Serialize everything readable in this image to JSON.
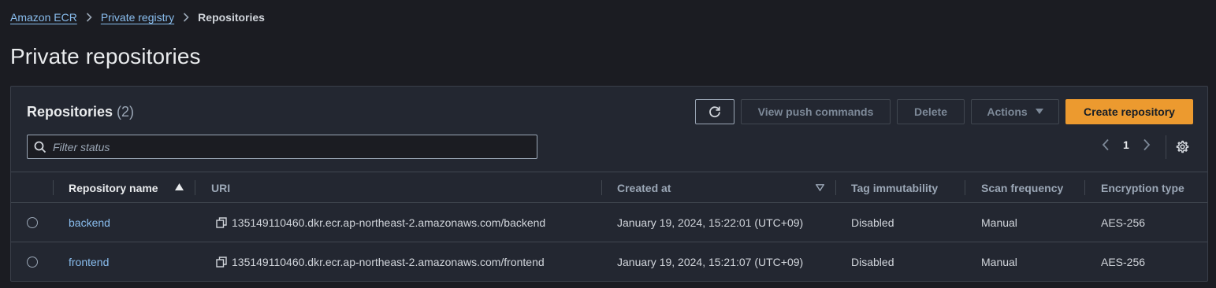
{
  "breadcrumb": {
    "items": [
      "Amazon ECR",
      "Private registry"
    ],
    "current": "Repositories"
  },
  "page": {
    "title": "Private repositories"
  },
  "panel": {
    "title": "Repositories",
    "count": "(2)",
    "buttons": {
      "view_push": "View push commands",
      "delete": "Delete",
      "actions": "Actions",
      "create": "Create repository"
    },
    "filter_placeholder": "Filter status",
    "pagination": {
      "page": "1"
    }
  },
  "table": {
    "columns": [
      "Repository name",
      "URI",
      "Created at",
      "Tag immutability",
      "Scan frequency",
      "Encryption type"
    ],
    "rows": [
      {
        "name": "backend",
        "uri": "135149110460.dkr.ecr.ap-northeast-2.amazonaws.com/backend",
        "created_at": "January 19, 2024, 15:22:01 (UTC+09)",
        "tag_immutability": "Disabled",
        "scan_frequency": "Manual",
        "encryption": "AES-256"
      },
      {
        "name": "frontend",
        "uri": "135149110460.dkr.ecr.ap-northeast-2.amazonaws.com/frontend",
        "created_at": "January 19, 2024, 15:21:07 (UTC+09)",
        "tag_immutability": "Disabled",
        "scan_frequency": "Manual",
        "encryption": "AES-256"
      }
    ]
  },
  "colors": {
    "background": "#1b1c22",
    "panel": "#232731",
    "link": "#89bdee",
    "primary": "#ec9a2f"
  }
}
